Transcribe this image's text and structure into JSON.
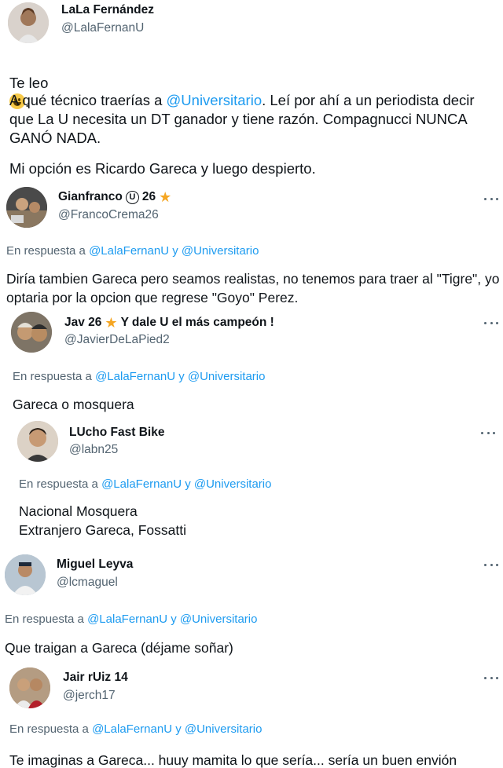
{
  "tweets": [
    {
      "name": "LaLa Fernández",
      "handle": "@LalaFernanU",
      "para1": "Te leo",
      "para2_prefix": "A qué técnico traerías a ",
      "para2_mention": "@Universitario",
      "para2_rest": ". Leí por ahí a un periodista decir que La U necesita un DT ganador y tiene razón. Compagnucci NUNCA GANÓ NADA.",
      "para3": "Mi opción es Ricardo Gareca y luego despierto.",
      "emoji": "grinning-face-emoji"
    },
    {
      "name": "Gianfranco",
      "name_suffix": "26",
      "handle": "@FrancoCrema26",
      "reply_prefix": "En respuesta a",
      "reply_user1": "@LalaFernanU",
      "reply_and": "y",
      "reply_user2": "@Universitario",
      "text": "Diría tambien Gareca pero seamos realistas, no tenemos para traer al \"Tigre\", yo optaria por la opcion que regrese \"Goyo\" Perez."
    },
    {
      "name": "Jav 26",
      "name_suffix": "Y dale U el más campeón !",
      "handle": "@JavierDeLaPied2",
      "reply_prefix": "En respuesta a",
      "reply_user1": "@LalaFernanU",
      "reply_and": "y",
      "reply_user2": "@Universitario",
      "text": "Gareca o mosquera"
    },
    {
      "name": "LUcho Fast Bike",
      "handle": "@labn25",
      "reply_prefix": "En respuesta a",
      "reply_user1": "@LalaFernanU",
      "reply_and": "y",
      "reply_user2": "@Universitario",
      "text": "Nacional  Mosquera\nExtranjero Gareca, Fossatti"
    },
    {
      "name": "Miguel Leyva",
      "handle": "@lcmaguel",
      "reply_prefix": "En respuesta a",
      "reply_user1": "@LalaFernanU",
      "reply_and": "y",
      "reply_user2": "@Universitario",
      "text": "Que traigan a Gareca (déjame soñar)"
    },
    {
      "name": "Jair rUiz 14",
      "handle": "@jerch17",
      "reply_prefix": "En respuesta a",
      "reply_user1": "@LalaFernanU",
      "reply_and": "y",
      "reply_user2": "@Universitario",
      "text": "Te imaginas a Gareca... huuy mamita lo que sería... sería un buen envión"
    }
  ],
  "colors": {
    "link": "#1d9bf0",
    "secondary": "#536471",
    "star": "#f5a623"
  }
}
